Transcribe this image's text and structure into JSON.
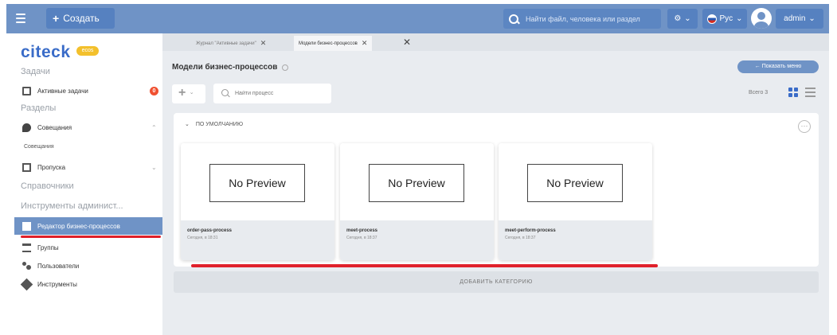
{
  "header": {
    "create_label": "Создать",
    "search_placeholder": "Найти файл, человека или раздел",
    "lang_label": "Рус",
    "user_label": "admin"
  },
  "sidebar": {
    "logo_text": "citeck",
    "logo_badge": "ecos",
    "tasks_heading": "Задачи",
    "active_tasks_label": "Активные задачи",
    "active_tasks_count": "0",
    "sections_heading": "Разделы",
    "meetings_label": "Совещания",
    "meetings_sub_label": "Совещания",
    "passes_label": "Пропуска",
    "references_heading": "Справочники",
    "admin_tools_heading": "Инструменты админист...",
    "bp_editor_label": "Редактор бизнес-процессов",
    "groups_label": "Группы",
    "users_label": "Пользователи",
    "tools_label": "Инструменты"
  },
  "tabs": [
    {
      "label": "Журнал \"Активные задачи\""
    },
    {
      "label": "Модели бизнес-процессов"
    }
  ],
  "main": {
    "page_title": "Модели бизнес-процессов",
    "show_menu_label": "Показать меню",
    "add_label": "+",
    "search_placeholder": "Найти процесс",
    "total_label": "Всего 3",
    "category_title": "ПО УМОЛЧАНИЮ",
    "add_category_label": "ДОБАВИТЬ КАТЕГОРИЮ",
    "cards": [
      {
        "preview": "No Preview",
        "name": "order-pass-process",
        "date": "Сегодня, в 18:31"
      },
      {
        "preview": "No Preview",
        "name": "meet-process",
        "date": "Сегодня, в 18:37"
      },
      {
        "preview": "No Preview",
        "name": "meet-perform-process",
        "date": "Сегодня, в 18:37"
      }
    ]
  },
  "colors": {
    "header_bg": "#6f93c6",
    "active_nav": "#6f93c6",
    "highlight_red": "#e0202a",
    "badge": "#f05030"
  }
}
